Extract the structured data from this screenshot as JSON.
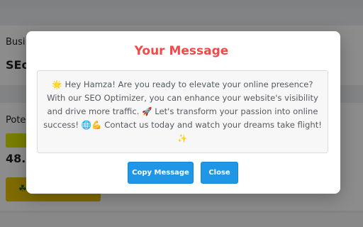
{
  "background": {
    "card1_label": "Busi",
    "card1_value": "SEo",
    "card2_label": "Pote",
    "card2_value": "48.8",
    "action_icon": "☘"
  },
  "modal": {
    "title": "Your Message",
    "message": "🌟 Hey Hamza! Are you ready to elevate your online presence? With our SEO Optimizer, you can enhance your website's visibility and drive more traffic. 🚀 Let's transform your passion into online success! 🌐💪 Contact us today and watch your dreams take flight! ✨",
    "copy_label": "Copy Message",
    "close_label": "Close"
  },
  "colors": {
    "title": "#f04a4a",
    "button": "#1f97e6"
  }
}
